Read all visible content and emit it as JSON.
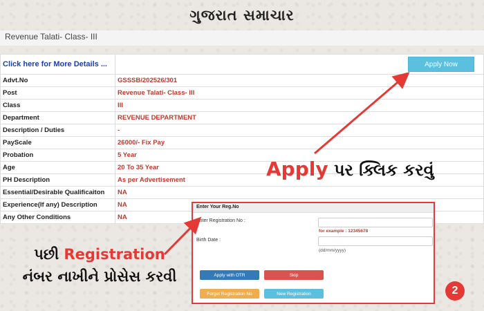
{
  "brand": {
    "name": "ગુજરાત સમાચાર"
  },
  "post_title": "Revenue Talati- Class- III",
  "more_details_link": "Click here for More Details ...",
  "apply_button": "Apply Now",
  "details": [
    {
      "label": "Advt.No",
      "value": "GSSSB/202526/301"
    },
    {
      "label": "Post",
      "value": "Revenue Talati- Class- III"
    },
    {
      "label": "Class",
      "value": "III"
    },
    {
      "label": "Department",
      "value": "REVENUE DEPARTMENT"
    },
    {
      "label": "Description / Duties",
      "value": "-"
    },
    {
      "label": "PayScale",
      "value": "26000/- Fix Pay"
    },
    {
      "label": "Probation",
      "value": "5 Year"
    },
    {
      "label": "Age",
      "value": "20 To 35 Year"
    },
    {
      "label": "PH Description",
      "value": "As per Advertisement"
    },
    {
      "label": "Essential/Desirable Qualificaiton",
      "value": "NA"
    },
    {
      "label": "Experience(If any) Description",
      "value": "NA"
    },
    {
      "label": "Any Other Conditions",
      "value": "NA"
    }
  ],
  "registration": {
    "header": "Enter Your Reg.No",
    "reg_label": "Enter Registration No :",
    "reg_value": "",
    "reg_hint": "for example : 12345678",
    "birth_label": "Birth Date :",
    "birth_value": "",
    "birth_hint": "(dd/mm/yyyy)",
    "buttons": {
      "apply_otr": "Apply with OTR",
      "skip": "Skip",
      "forget": "Forget Registration No",
      "new_reg": "New Registration"
    }
  },
  "annotations": {
    "apply_word": "Apply",
    "apply_rest": " પર ક્લિક કરવું",
    "reg_prefix": "પછી ",
    "reg_word": "Registration",
    "reg_line2": "નંબર નાખીને પ્રોસેસ કરવી",
    "step": "2"
  },
  "colors": {
    "accent_red": "#e53935",
    "value_red": "#c0392b",
    "link_blue": "#1b3fae",
    "apply_blue": "#5bc0de"
  }
}
